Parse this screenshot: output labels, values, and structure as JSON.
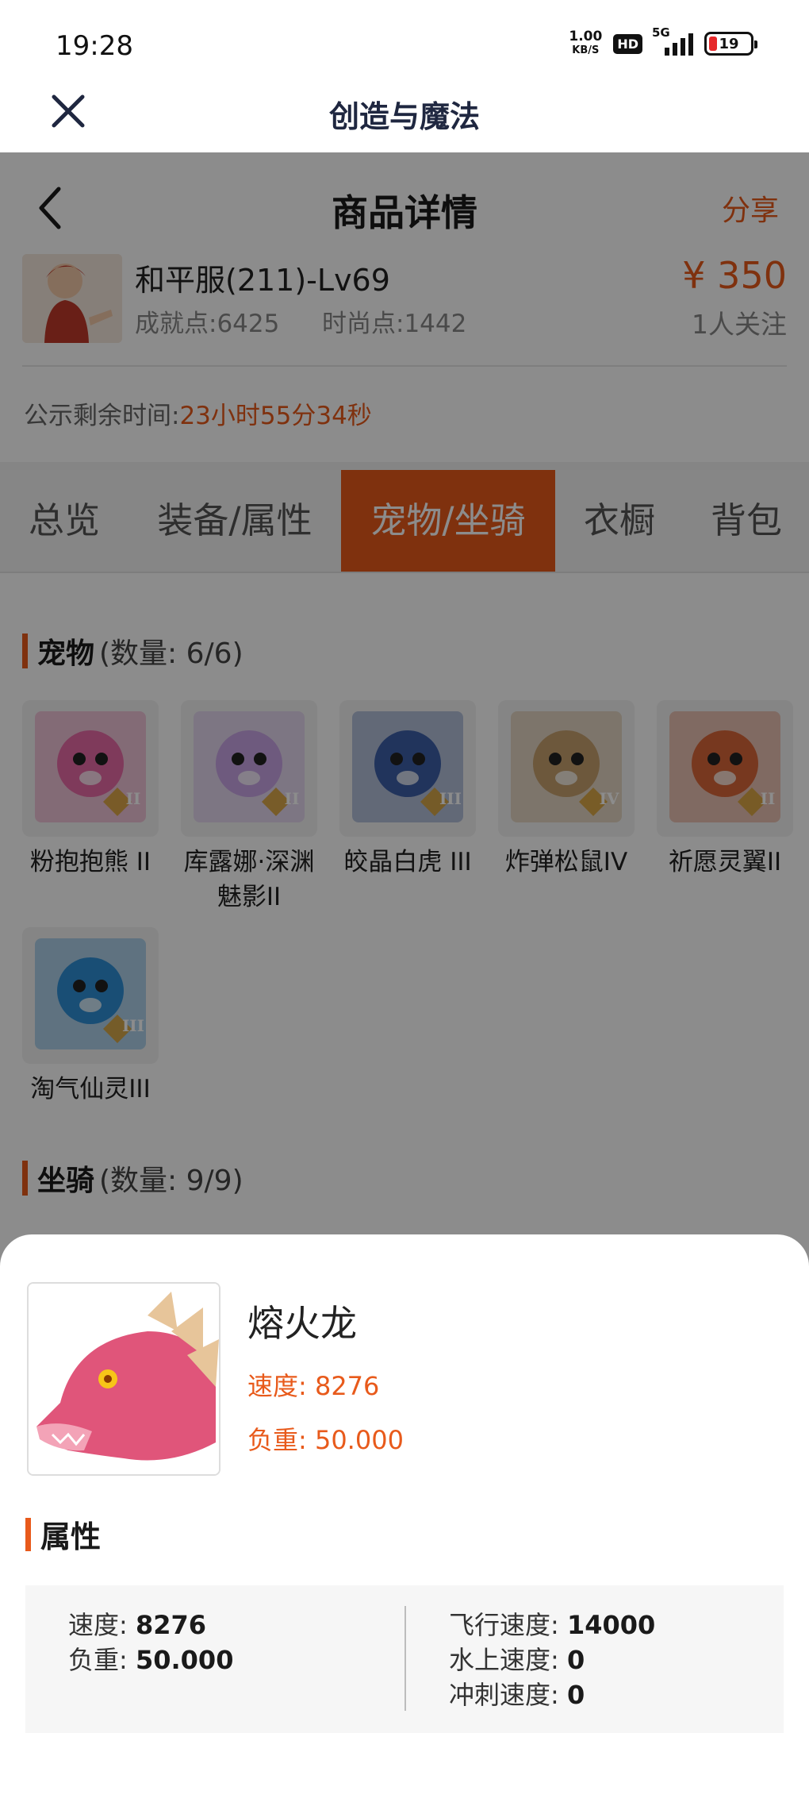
{
  "status_bar": {
    "time": "19:28",
    "net_speed_value": "1.00",
    "net_speed_unit": "KB/S",
    "hd": "HD",
    "network": "5G",
    "battery": "19"
  },
  "titlebar": {
    "title": "创造与魔法",
    "close_icon": "close-icon"
  },
  "nav": {
    "title": "商品详情",
    "share": "分享",
    "back_icon": "chevron-left-icon"
  },
  "summary": {
    "server": "和平服(211)-Lv69",
    "achievement": "成就点:6425",
    "fashion": "时尚点:1442",
    "price": "¥ 350",
    "followers": "1人关注",
    "countdown_label": "公示剩余时间:",
    "countdown_value": "23小时55分34秒"
  },
  "tabs": [
    "总览",
    "装备/属性",
    "宠物/坐骑",
    "衣橱",
    "背包"
  ],
  "active_tab": "宠物/坐骑",
  "pets": {
    "title": "宠物",
    "count": "(数量: 6/6)",
    "items": [
      {
        "name": "粉抱抱熊 II",
        "tier": "II",
        "color": "#e86aa6"
      },
      {
        "name": "库露娜·深渊魅影II",
        "tier": "II",
        "color": "#c9a4e6"
      },
      {
        "name": "皎晶白虎 III",
        "tier": "III",
        "color": "#3c5fa8"
      },
      {
        "name": "炸弹松鼠IV",
        "tier": "IV",
        "color": "#c6a06e"
      },
      {
        "name": "祈愿灵翼II",
        "tier": "II",
        "color": "#d9673a"
      },
      {
        "name": "淘气仙灵III",
        "tier": "III",
        "color": "#2f8ed6"
      }
    ]
  },
  "mounts": {
    "title": "坐骑",
    "count": "(数量: 9/9)"
  },
  "sheet": {
    "name": "熔火龙",
    "speed_line": "速度: 8276",
    "load_line": "负重: 50.000",
    "attr_title": "属性",
    "attrs_left": [
      {
        "label": "速度:",
        "value": "8276"
      },
      {
        "label": "负重:",
        "value": "50.000"
      }
    ],
    "attrs_right": [
      {
        "label": "飞行速度:",
        "value": "14000"
      },
      {
        "label": "水上速度:",
        "value": "0"
      },
      {
        "label": "冲刺速度:",
        "value": "0"
      }
    ]
  },
  "colors": {
    "accent": "#e85a1b",
    "title_text": "#1f2740"
  }
}
